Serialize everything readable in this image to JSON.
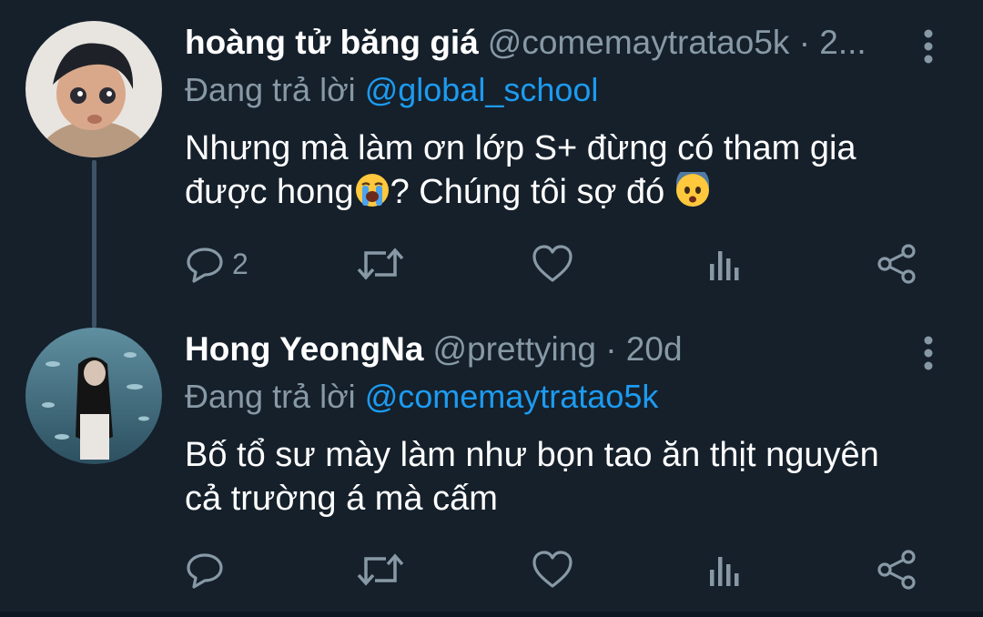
{
  "tweets": [
    {
      "name": "hoàng tử băng giá",
      "handle": "@comemaytratao5k · 2...",
      "reply_prefix": "Đang trả lời",
      "reply_to": "@global_school",
      "text_line1": "Nhưng mà làm ơn lớp S+ đừng có tham gia",
      "text_line2a": "được hong",
      "text_line2b": "? Chúng tôi sợ đó ",
      "emoji1": "loudly-crying-face",
      "emoji2": "anxious-face",
      "reply_count": "2"
    },
    {
      "name": "Hong YeongNa",
      "handle": "@prettying · 20d",
      "reply_prefix": "Đang trả lời",
      "reply_to": "@comemaytratao5k",
      "text_line1": "Bố tổ sư mày làm như bọn tao ăn thịt nguyên",
      "text_line2": "cả trường á mà cấm",
      "reply_count": ""
    }
  ],
  "colors": {
    "background": "#15202b",
    "secondary_text": "#8899a6",
    "link": "#1d9bf0",
    "thread_line": "#3d5466"
  }
}
